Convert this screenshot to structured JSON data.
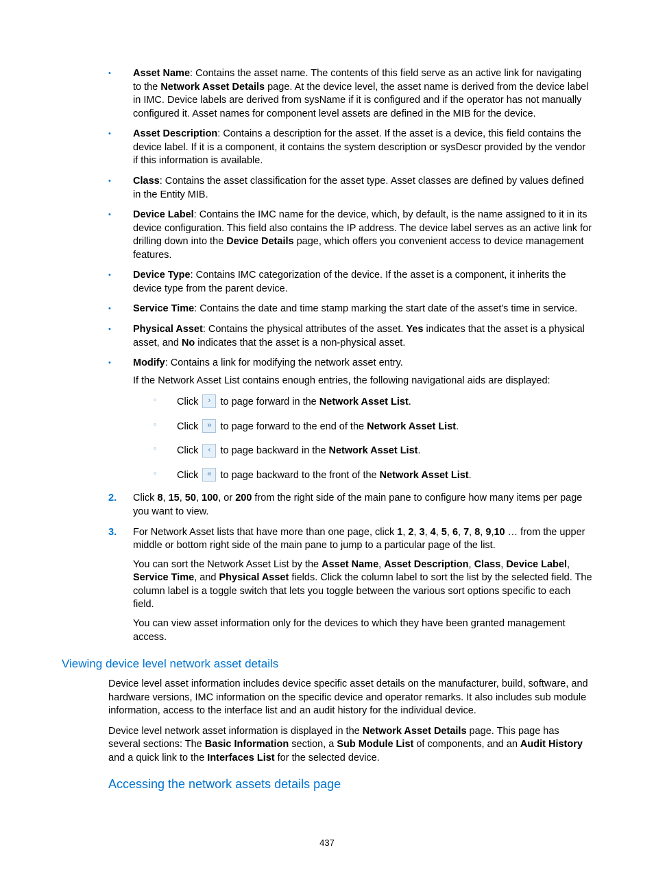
{
  "bullets": [
    {
      "term": "Asset Name",
      "text": ": Contains the asset name. The contents of this field serve as an active link for navigating to the ",
      "bold1": "Network Asset Details",
      "text2": " page. At the device level, the asset name is derived from the device label in IMC. Device labels are derived from sysName if it is configured and if the operator has not manually configured it. Asset names for component level assets are defined in the MIB for the device."
    },
    {
      "term": "Asset Description",
      "text": ": Contains a description for the asset. If the asset is a device, this field contains the device label. If it is a component, it contains the system description or sysDescr provided by the vendor if this information is available."
    },
    {
      "term": "Class",
      "text": ": Contains the asset classification for the asset type. Asset classes are defined by values defined in the Entity MIB."
    },
    {
      "term": "Device Label",
      "text": ": Contains the IMC name for the device, which, by default, is the name assigned to it in its device configuration. This field also contains the IP address. The device label serves as an active link for drilling down into the ",
      "bold1": "Device Details",
      "text2": " page, which offers you convenient access to device management features."
    },
    {
      "term": "Device Type",
      "text": ": Contains IMC categorization of the device. If the asset is a component, it inherits the device type from the parent device."
    },
    {
      "term": "Service Time",
      "text": ": Contains the date and time stamp marking the start date of the asset's time in service."
    },
    {
      "term": "Physical Asset",
      "text": ": Contains the physical attributes of the asset. ",
      "bold1": "Yes",
      "text2": " indicates that the asset is a physical asset, and ",
      "bold2": "No",
      "text3": " indicates that the asset is a non-physical asset."
    }
  ],
  "modify": {
    "term": "Modify",
    "text": ": Contains a link for modifying the network asset entry.",
    "after": "If the Network Asset List contains enough entries, the following navigational aids are displayed:",
    "sub": [
      {
        "pre": "Click ",
        "icon": "›",
        "post1": " to page forward in the ",
        "bold": "Network Asset List",
        "post2": "."
      },
      {
        "pre": "Click ",
        "icon": "»",
        "post1": " to page forward to the end of the ",
        "bold": "Network Asset List",
        "post2": "."
      },
      {
        "pre": "Click ",
        "icon": "‹",
        "post1": " to page backward in the ",
        "bold": "Network Asset List",
        "post2": "."
      },
      {
        "pre": "Click ",
        "icon": "«",
        "post1": " to page backward to the front of the ",
        "bold": "Network Asset List",
        "post2": "."
      }
    ]
  },
  "steps": {
    "s2": {
      "num": "2.",
      "pre": "Click ",
      "b1": "8",
      "c1": ", ",
      "b2": "15",
      "c2": ", ",
      "b3": "50",
      "c3": ", ",
      "b4": "100",
      "c4": ", or ",
      "b5": "200",
      "post": " from the right side of the main pane to configure how many items per page you want to view."
    },
    "s3": {
      "num": "3.",
      "p1a": "For Network Asset lists that have more than one page, click ",
      "nums": [
        "1",
        "2",
        "3",
        "4",
        "5",
        "6",
        "7",
        "8",
        "9",
        "10"
      ],
      "p1b": " … from the upper middle or bottom right side of the main pane to jump to a particular page of the list.",
      "p2a": "You can sort the Network Asset List by the ",
      "f1": "Asset Name",
      "c1": ", ",
      "f2": "Asset Description",
      "c2": ", ",
      "f3": "Class",
      "c3": ", ",
      "f4": "Device Label",
      "c4": ", ",
      "f5": "Service Time",
      "c5": ", and ",
      "f6": "Physical Asset",
      "p2b": " fields. Click the column label to sort the list by the selected field. The column label is a toggle switch that lets you toggle between the various sort options specific to each field.",
      "p3": "You can view asset information only for the devices to which they have been granted management access."
    }
  },
  "section": {
    "h2": "Viewing device level network asset details",
    "p1": "Device level asset information includes device specific asset details on the manufacturer, build, software, and hardware versions, IMC information on the specific device and operator remarks. It also includes sub module information, access to the interface list and an audit history for the individual device.",
    "p2a": "Device level network asset information is displayed in the ",
    "b1": "Network Asset Details",
    "p2b": " page. This page has several sections: The ",
    "b2": "Basic Information",
    "p2c": " section, a ",
    "b3": "Sub Module List",
    "p2d": " of components, and an ",
    "b4": "Audit History",
    "p2e": " and a quick link to the ",
    "b5": "Interfaces List",
    "p2f": " for the selected device.",
    "h3": "Accessing the network assets details page"
  },
  "pagenum": "437"
}
